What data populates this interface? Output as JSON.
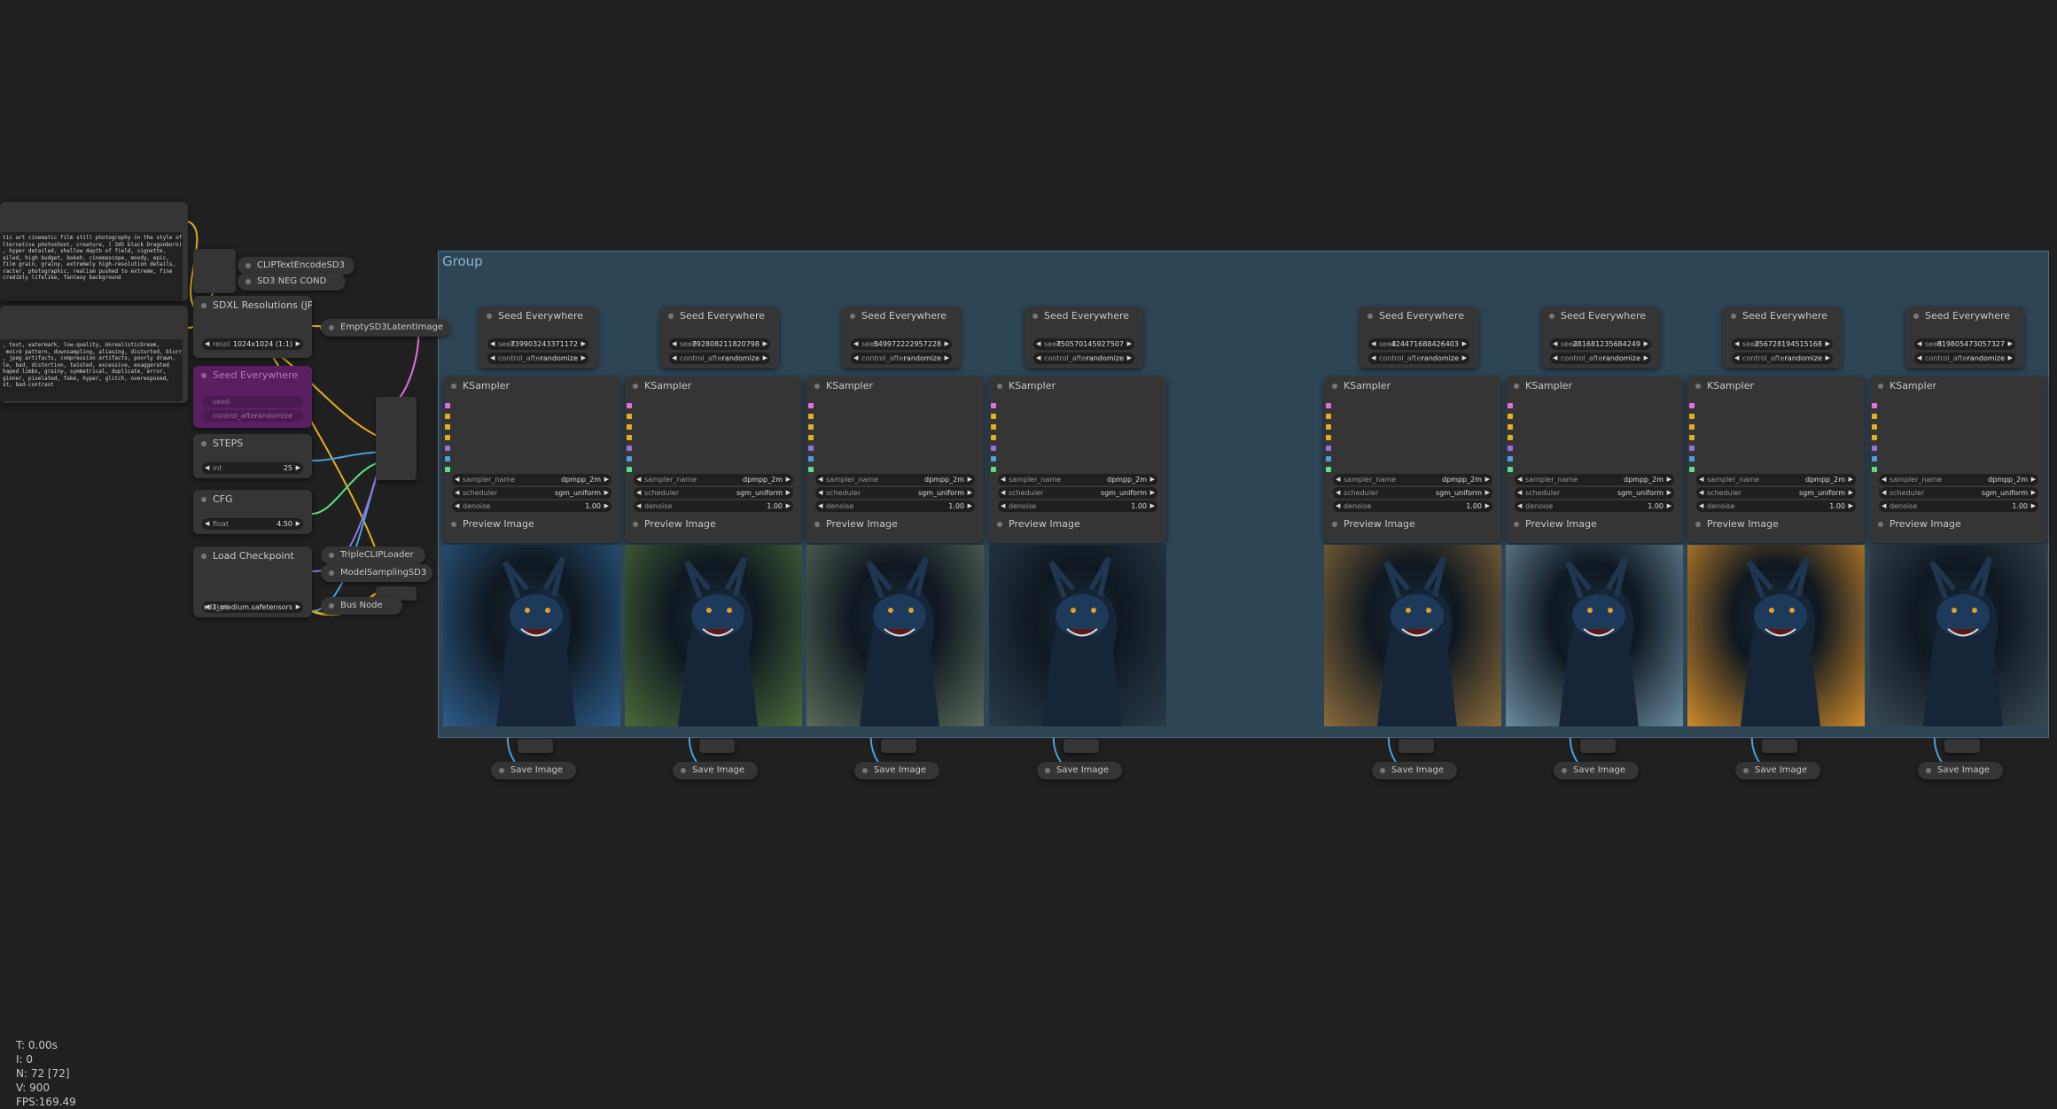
{
  "canvas": {
    "background": "#202020"
  },
  "group": {
    "title": "Group",
    "color": "#2e4556"
  },
  "prompts": {
    "positive": "tic art cinematic film still photography in the style of\nlternative photoshoot, creature, ( 3d5 black Dragonborn)\n, hyper detailed, shallow depth of field, vignette,\nailed, high budget, bokeh, cinemascope, moody, epic,\nfilm grain, grainy, extremely high-resolution details,\nracter, photographic, realism pushed to extreme, fine\ncredibly lifelike, fantasy background",
    "negative": ", text, watermark, low-quality, UnrealisticDream,\n moiré pattern, downsampling, aliasing, distorted, blurry,\n, jpeg artifacts, compression artifacts, poorly drawn,\nle, bad, distortion, twisted, excessive, exaggerated\nhaped limbs, grainy, symmetrical, duplicate, error,\nginner, pixelated, fake, hyper, glitch, overexposed,\nst, bad-contrast"
  },
  "left_nodes": {
    "clip_text_encode": "CLIPTextEncodeSD3",
    "neg_cond": "SD3 NEG COND",
    "sdxl_res": {
      "title": "SDXL Resolutions (JPS)",
      "label": "resol",
      "value": "1024x1024 (1:1)"
    },
    "empty_latent": "EmptySD3LatentImage",
    "seed_bypassed": {
      "title": "Seed Everywhere",
      "row1": "seed",
      "row2": "control_after",
      "row2_value": "randomize"
    },
    "steps": {
      "title": "STEPS",
      "label": "int",
      "value": "25"
    },
    "cfg": {
      "title": "CFG",
      "label": "float",
      "value": "4.50"
    },
    "checkpoint": {
      "title": "Load Checkpoint",
      "label": "ckpt",
      "value": "sd3_medium.safetensors"
    },
    "triple_clip": "TripleCLIPLoader",
    "model_sampling": "ModelSamplingSD3",
    "bus": "Bus Node"
  },
  "columns": [
    {
      "seed": "739903243371172",
      "image_hue": "#2d5c8a"
    },
    {
      "seed": "792808211820798",
      "image_hue": "#4a6a3a"
    },
    {
      "seed": "549972222957228",
      "image_hue": "#5a6a5a"
    },
    {
      "seed": "750570145927507",
      "image_hue": "#2a3a4a"
    },
    {
      "seed": "424471688426403",
      "image_hue": "#8a6a3a"
    },
    {
      "seed": "281681235684249",
      "image_hue": "#6a8aa0"
    },
    {
      "seed": "256728194515168",
      "image_hue": "#d08a2a"
    },
    {
      "seed": "819805473057327",
      "image_hue": "#3a4a50"
    }
  ],
  "labels": {
    "seed_node": "Seed Everywhere",
    "seed_label": "seed",
    "control_label": "control_after",
    "control_value": "randomize",
    "ksampler": "KSampler",
    "sampler_label": "sampler_name",
    "sampler_value": "dpmpp_2m",
    "scheduler_label": "scheduler",
    "scheduler_value": "sgm_uniform",
    "denoise_label": "denoise",
    "denoise_value": "1.00",
    "preview": "Preview Image",
    "save": "Save Image"
  },
  "stats": {
    "t": "T: 0.00s",
    "i": "I: 0",
    "n": "N: 72 [72]",
    "v": "V: 900",
    "fps": "FPS:169.49"
  }
}
